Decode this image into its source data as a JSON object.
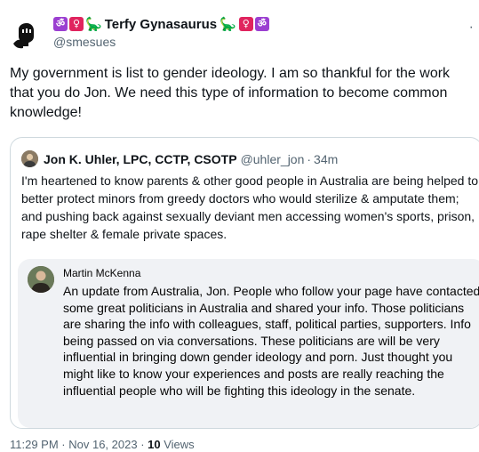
{
  "author": {
    "display_name": "Terfy Gynasaurus",
    "handle": "@smesues",
    "badges": [
      "om-badge-icon",
      "female-sign-badge-icon",
      "dinosaur-icon"
    ]
  },
  "tweet": {
    "text": "My government is list to gender ideology. I am so thankful for the work that you do Jon. We need this type of information to become common knowledge!"
  },
  "quote": {
    "author_name": "Jon K. Uhler, LPC, CCTP, CSOTP",
    "handle": "@uhler_jon",
    "separator": "·",
    "time": "34m",
    "text": "I'm heartened to know parents & other good people in Australia are being helped to better protect minors from greedy doctors who would sterilize & amputate them; and pushing back against sexually deviant men accessing women's sports, prison, rape shelter & female private spaces.",
    "embedded_post": {
      "author_name": "Martin McKenna",
      "text": "An update from Australia, Jon. People who follow your page have contacted some great politicians in Australia and shared your info. Those politicians are sharing the info with colleagues, staff, political parties, supporters. Info being passed on via conversations. These politicians are will be very influential in bringing down gender ideology and porn. Just thought you might like to know your experiences and posts are really reaching the influential people who will be fighting this ideology in the senate."
    }
  },
  "footer": {
    "timestamp": "11:29 PM · Nov 16, 2023",
    "separator": " · ",
    "views_count": "10",
    "views_label": "Views"
  },
  "colors": {
    "text_primary": "#0f1419",
    "text_secondary": "#536471",
    "border": "#cfd9de",
    "embedded_bg": "#f0f2f5",
    "badge_purple": "#9b3fd1",
    "badge_red": "#e0245e"
  }
}
